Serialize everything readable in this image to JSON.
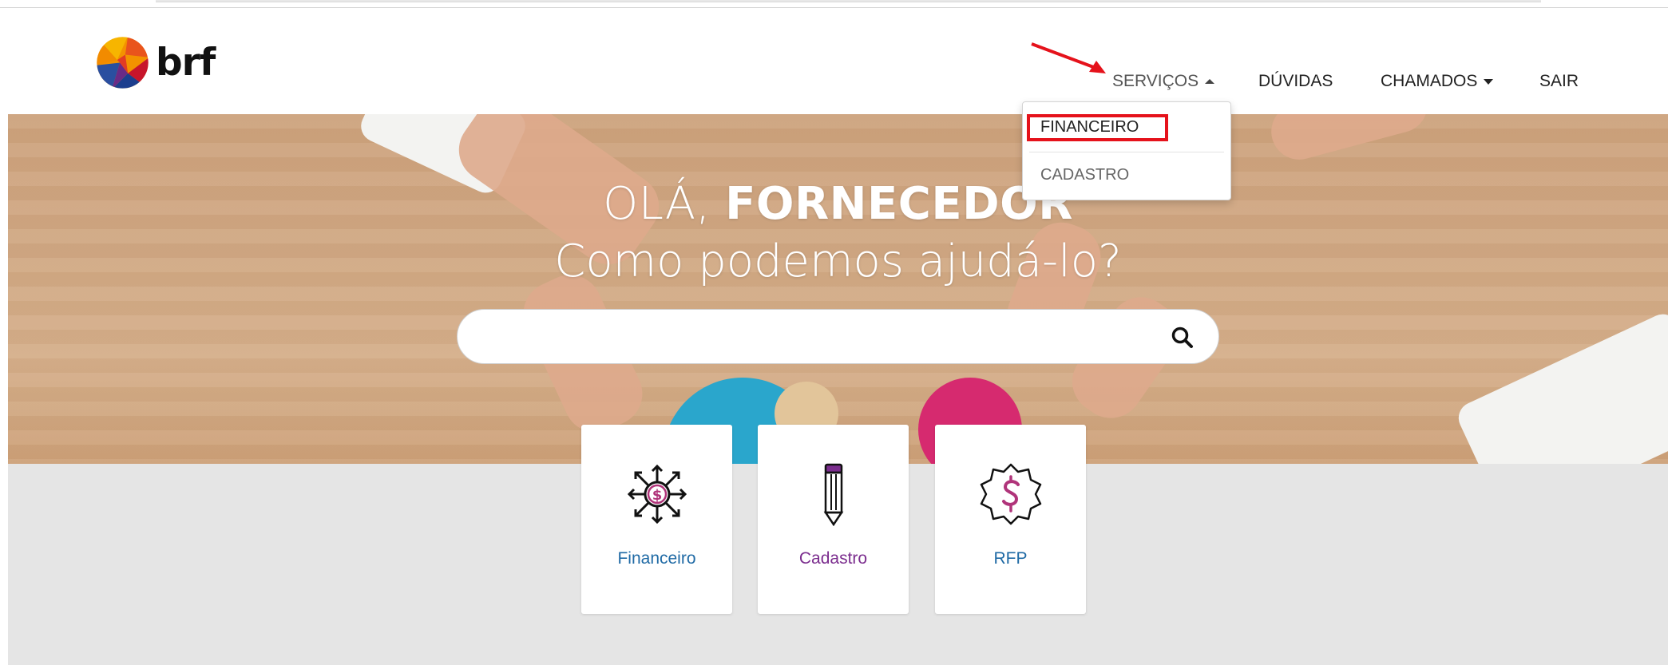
{
  "brand": {
    "logo_text": "brf"
  },
  "nav": {
    "items": [
      {
        "label": "SERVIÇOS"
      },
      {
        "label": "DÚVIDAS"
      },
      {
        "label": "CHAMADOS"
      },
      {
        "label": "SAIR"
      }
    ]
  },
  "dropdown": {
    "items": [
      {
        "label": "FINANCEIRO"
      },
      {
        "label": "CADASTRO"
      }
    ]
  },
  "hero": {
    "greeting": "OLÁ,",
    "greeting_bold": "FORNECEDOR",
    "subtitle": "Como podemos ajudá-lo?"
  },
  "search": {
    "value": "",
    "icon": "search-icon"
  },
  "cards": [
    {
      "label": "Financeiro",
      "icon": "finance-gear-icon",
      "color": "#1f6aa5"
    },
    {
      "label": "Cadastro",
      "icon": "pencil-icon",
      "color": "#7b2d8e"
    },
    {
      "label": "RFP",
      "icon": "dollar-badge-icon",
      "color": "#1f6aa5"
    }
  ],
  "colors": {
    "accent_magenta": "#b0347a",
    "annotation_red": "#e5121b"
  }
}
